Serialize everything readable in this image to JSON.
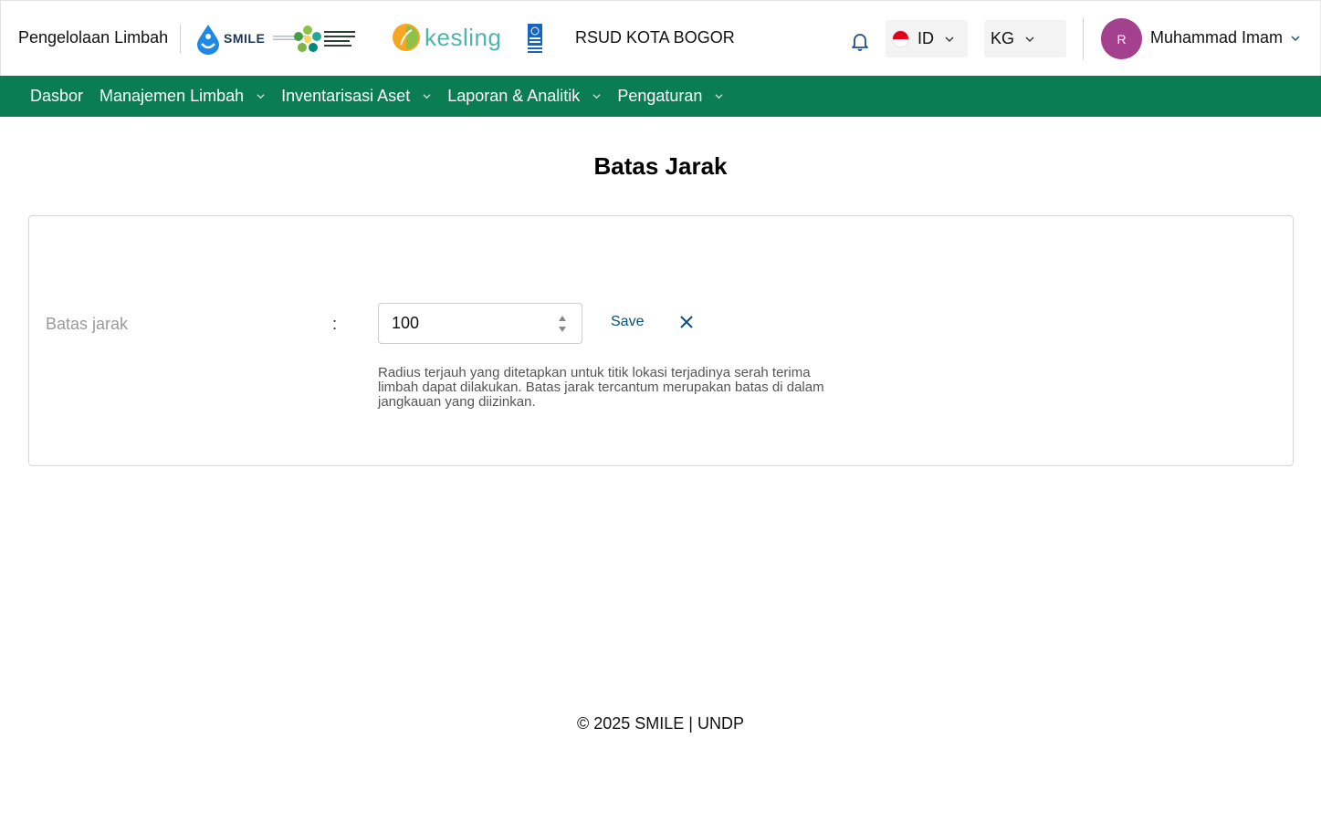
{
  "header": {
    "app_title": "Pengelolaan Limbah",
    "logos": {
      "smile": "SMILE",
      "kemenkes": "KEMENTERIAN KESEHATAN REPUBLIK INDONESIA",
      "kesling": "kesling",
      "undp": "UNDP"
    },
    "hospital_name": "RSUD KOTA BOGOR",
    "language": "ID",
    "unit": "KG",
    "user": {
      "initial": "R",
      "name": "Muhammad Imam"
    },
    "icons": {
      "bell": "bell-icon",
      "chevron": "chevron-down-icon"
    }
  },
  "nav": {
    "items": [
      {
        "label": "Dasbor",
        "has_dropdown": false
      },
      {
        "label": "Manajemen Limbah",
        "has_dropdown": true
      },
      {
        "label": "Inventarisasi Aset",
        "has_dropdown": true
      },
      {
        "label": "Laporan & Analitik",
        "has_dropdown": true
      },
      {
        "label": "Pengaturan",
        "has_dropdown": true
      }
    ]
  },
  "main": {
    "title": "Batas Jarak",
    "field": {
      "label": "Batas jarak",
      "separator": ":",
      "value": "100",
      "save_label": "Save",
      "help_text": "Radius terjauh yang ditetapkan untuk titik lokasi terjadinya serah terima limbah dapat dilakukan. Batas jarak tercantum merupakan batas di dalam jangkauan yang diizinkan."
    }
  },
  "footer": {
    "text": "© 2025 SMILE | UNDP"
  },
  "colors": {
    "nav_bg": "#0a7d52",
    "avatar_bg": "#a3418f",
    "save_text": "#0b4f7d",
    "flag_red": "#e3001b"
  }
}
